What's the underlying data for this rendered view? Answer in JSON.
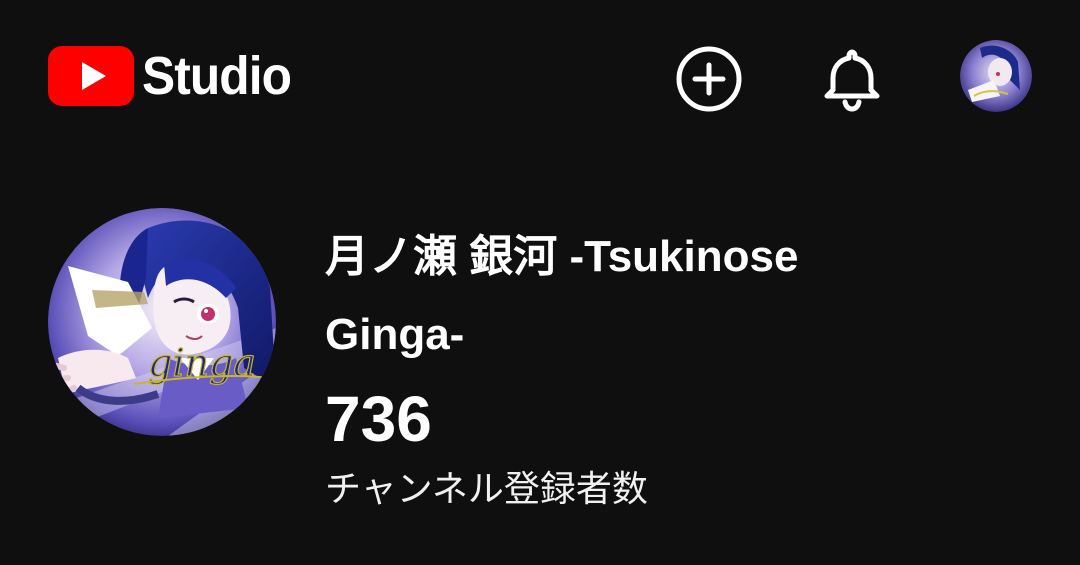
{
  "app": {
    "title": "Studio",
    "icons": {
      "logo": "youtube-play-icon",
      "create": "add-circle-icon",
      "notifications": "bell-icon",
      "account": "avatar"
    },
    "colors": {
      "background": "#0f0f0f",
      "brand_red": "#ff0000",
      "text": "#ffffff"
    }
  },
  "channel": {
    "name": "月ノ瀬 銀河 -Tsukinose Ginga-",
    "subscriber_count": "736",
    "subscriber_label": "チャンネル登録者数",
    "avatar_text": "ginga"
  }
}
